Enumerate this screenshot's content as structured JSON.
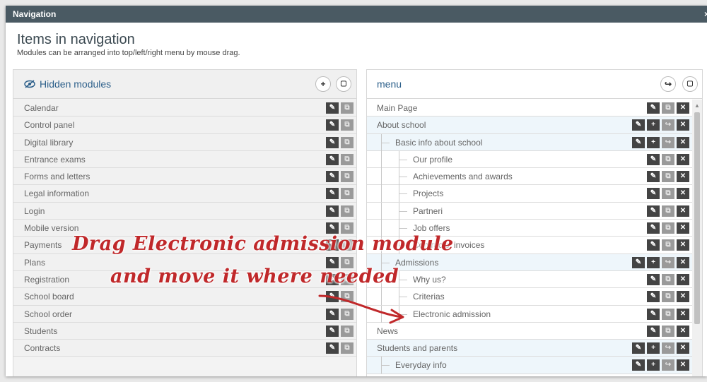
{
  "window": {
    "title": "Navigation",
    "close_glyph": "×"
  },
  "header": {
    "title": "Items in navigation",
    "subtitle": "Modules can be arranged into top/left/right menu by mouse drag."
  },
  "left_panel": {
    "title": "Hidden modules",
    "buttons": [
      "+",
      "▢"
    ],
    "items": [
      {
        "label": "Calendar"
      },
      {
        "label": "Control panel"
      },
      {
        "label": "Digital library"
      },
      {
        "label": "Entrance exams"
      },
      {
        "label": "Forms and letters"
      },
      {
        "label": "Legal information"
      },
      {
        "label": "Login"
      },
      {
        "label": "Mobile version"
      },
      {
        "label": "Payments"
      },
      {
        "label": "Plans"
      },
      {
        "label": "Registration"
      },
      {
        "label": "School board"
      },
      {
        "label": "School order"
      },
      {
        "label": "Students"
      },
      {
        "label": "Contracts"
      }
    ]
  },
  "right_panel": {
    "title": "menu",
    "buttons": [
      "↪",
      "▢"
    ],
    "items": [
      {
        "label": "Main Page",
        "level": 0,
        "group": false
      },
      {
        "label": "About school",
        "level": 0,
        "group": true
      },
      {
        "label": "Basic info about school",
        "level": 1,
        "group": true
      },
      {
        "label": "Our profile",
        "level": 2,
        "group": false
      },
      {
        "label": "Achievements and awards",
        "level": 2,
        "group": false
      },
      {
        "label": "Projects",
        "level": 2,
        "group": false
      },
      {
        "label": "Partneri",
        "level": 2,
        "group": false
      },
      {
        "label": "Job offers",
        "level": 2,
        "group": false
      },
      {
        "label": "Contracts, invoices",
        "level": 2,
        "group": false
      },
      {
        "label": "Admissions",
        "level": 1,
        "group": true
      },
      {
        "label": "Why us?",
        "level": 2,
        "group": false
      },
      {
        "label": "Criterias",
        "level": 2,
        "group": false
      },
      {
        "label": "Electronic admission",
        "level": 2,
        "group": false
      },
      {
        "label": "News",
        "level": 0,
        "group": false
      },
      {
        "label": "Students and parents",
        "level": 0,
        "group": true
      },
      {
        "label": "Everyday info",
        "level": 1,
        "group": true
      }
    ]
  },
  "annotation": {
    "line1": "Drag Electronic admission module",
    "line2": "and move it where needed",
    "color": "#c0282a"
  },
  "colors": {
    "titlebar": "#4a5a63",
    "accent": "#2c5f8a",
    "action_button": "#444444"
  }
}
